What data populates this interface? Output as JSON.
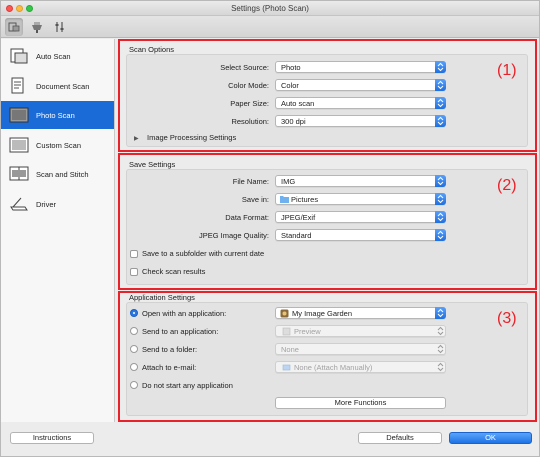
{
  "window": {
    "title": "Settings (Photo Scan)"
  },
  "toolbar": {
    "icons": [
      "scan-from-computer-icon",
      "scan-from-panel-icon",
      "general-settings-icon"
    ]
  },
  "sidebar": {
    "items": [
      {
        "label": "Auto Scan",
        "icon": "auto-scan-icon"
      },
      {
        "label": "Document Scan",
        "icon": "document-scan-icon"
      },
      {
        "label": "Photo Scan",
        "icon": "photo-scan-icon",
        "active": true
      },
      {
        "label": "Custom Scan",
        "icon": "custom-scan-icon"
      },
      {
        "label": "Scan and Stitch",
        "icon": "scan-and-stitch-icon"
      },
      {
        "label": "Driver",
        "icon": "driver-icon"
      }
    ]
  },
  "scan_options": {
    "title": "Scan Options",
    "marker": "(1)",
    "select_source": {
      "label": "Select Source:",
      "value": "Photo"
    },
    "color_mode": {
      "label": "Color Mode:",
      "value": "Color"
    },
    "paper_size": {
      "label": "Paper Size:",
      "value": "Auto scan"
    },
    "resolution": {
      "label": "Resolution:",
      "value": "300 dpi"
    },
    "image_processing": "Image Processing Settings"
  },
  "save_settings": {
    "title": "Save Settings",
    "marker": "(2)",
    "file_name": {
      "label": "File Name:",
      "value": "IMG"
    },
    "save_in": {
      "label": "Save in:",
      "value": "Pictures"
    },
    "data_format": {
      "label": "Data Format:",
      "value": "JPEG/Exif"
    },
    "jpeg_quality": {
      "label": "JPEG Image Quality:",
      "value": "Standard"
    },
    "subfolder_check": {
      "label": "Save to a subfolder with current date",
      "checked": false
    },
    "check_results": {
      "label": "Check scan results",
      "checked": false
    }
  },
  "app_settings": {
    "title": "Application Settings",
    "marker": "(3)",
    "open_with": {
      "label": "Open with an application:",
      "value": "My Image Garden",
      "selected": true
    },
    "send_app": {
      "label": "Send to an application:",
      "value": "Preview"
    },
    "send_folder": {
      "label": "Send to a folder:",
      "value": "None"
    },
    "attach_email": {
      "label": "Attach to e-mail:",
      "value": "None (Attach Manually)"
    },
    "no_app": {
      "label": "Do not start any application"
    },
    "more_functions": "More Functions"
  },
  "footer": {
    "instructions": "Instructions",
    "defaults": "Defaults",
    "ok": "OK"
  },
  "colors": {
    "accent": "#1a6ad7",
    "highlight": "#e8222a"
  }
}
